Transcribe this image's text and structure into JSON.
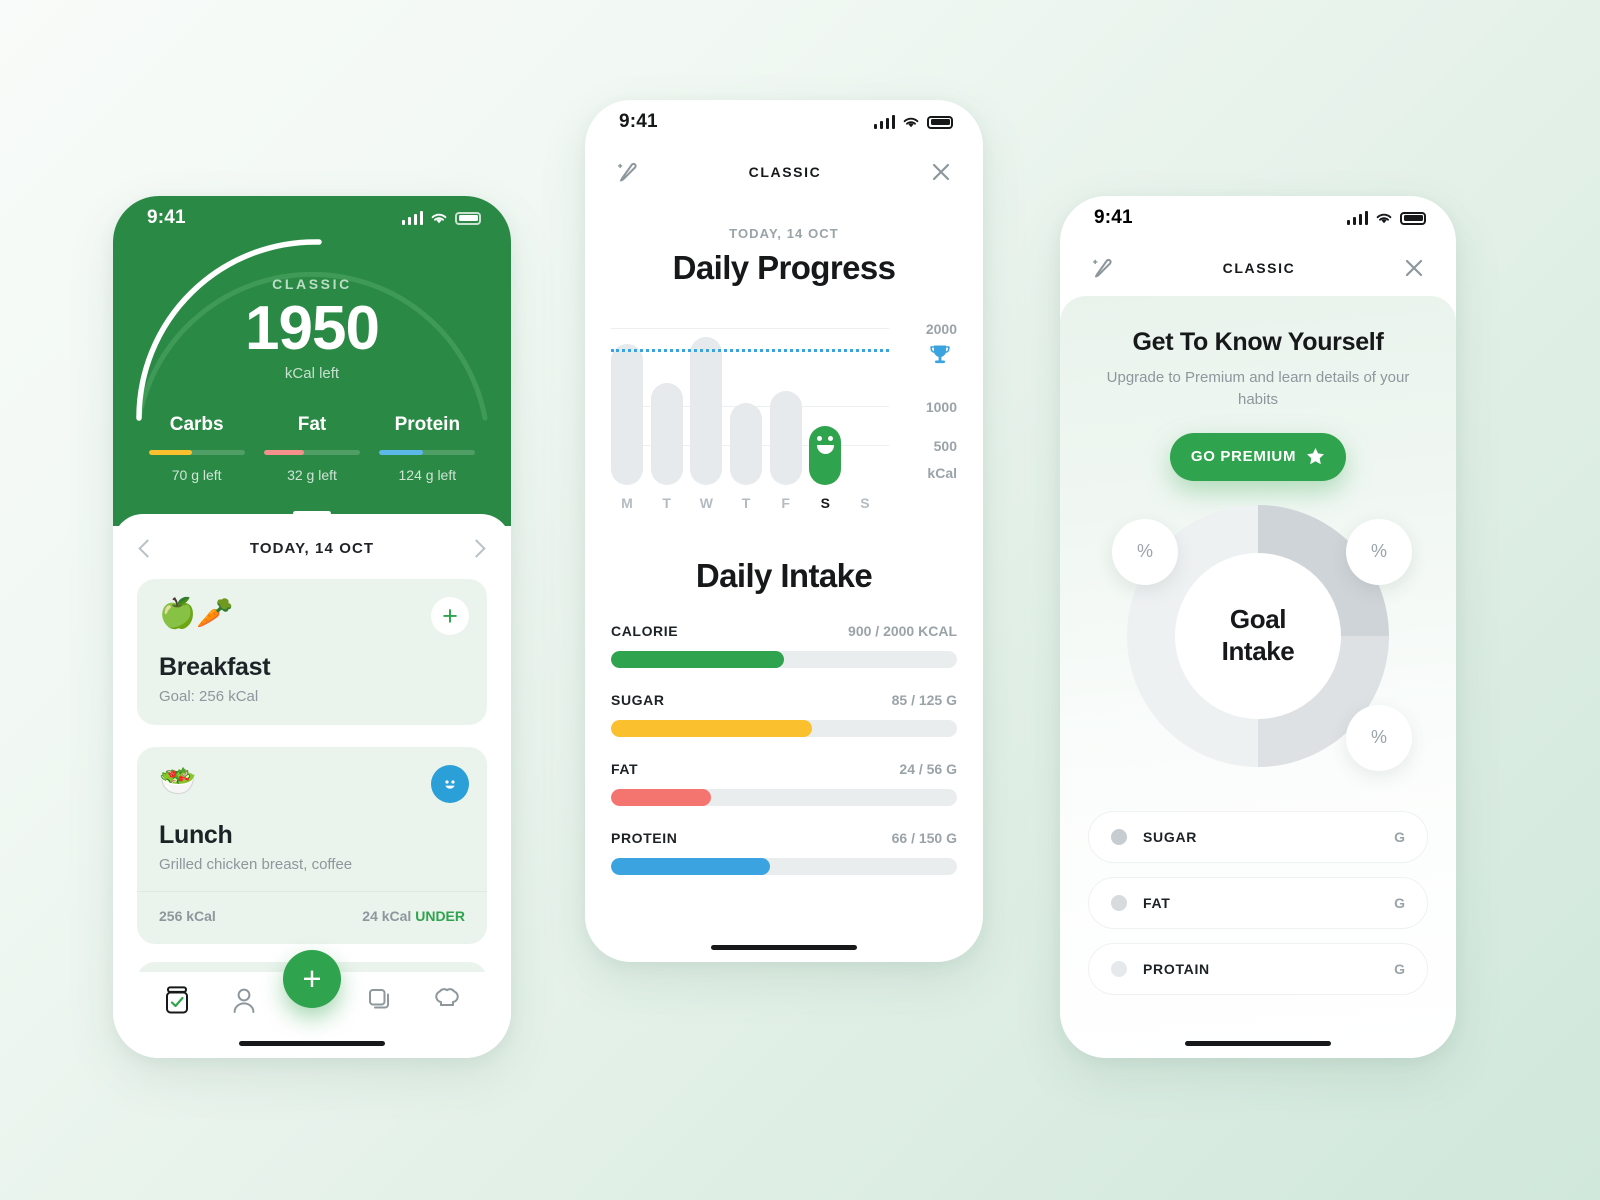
{
  "theme": {
    "green": "#2fa34d",
    "dark_green": "#2a8a45",
    "yellow": "#fbc02d",
    "red": "#f4756f",
    "blue": "#3aa3e0",
    "grey": "#e6eaec"
  },
  "phone1": {
    "status": {
      "time": "9:41"
    },
    "gauge": {
      "label": "CLASSIC",
      "value": "1950",
      "unit": "kCal left"
    },
    "macros": [
      {
        "name": "Carbs",
        "left": "70 g left",
        "pct": 45,
        "color": "#fbc02d"
      },
      {
        "name": "Fat",
        "left": "32 g left",
        "pct": 42,
        "color": "#f4918c"
      },
      {
        "name": "Protein",
        "left": "124 g left",
        "pct": 46,
        "color": "#5bb8e8"
      }
    ],
    "date_nav": {
      "title": "TODAY, 14 OCT",
      "prev": "‹",
      "next": "›"
    },
    "meals": [
      {
        "emoji": "🥗",
        "icon_name": "apple-carrot-emoji",
        "title": "Breakfast",
        "subtitle": "Goal: 256 kCal",
        "badge": "add"
      },
      {
        "emoji": "🥗",
        "icon_name": "salad-emoji",
        "title": "Lunch",
        "subtitle": "Grilled chicken breast, coffee",
        "badge": "smiley",
        "foot_left": "256 kCal",
        "foot_right": "24 kCal",
        "foot_tag": "UNDER"
      }
    ],
    "fab": "+",
    "tabs": [
      {
        "name": "diary",
        "icon": "checklist-icon"
      },
      {
        "name": "profile",
        "icon": "person-icon"
      },
      {
        "name": "plans",
        "icon": "layers-icon"
      },
      {
        "name": "recipes",
        "icon": "chef-hat-icon"
      }
    ]
  },
  "phone2": {
    "status": {
      "time": "9:41"
    },
    "navbar": {
      "title": "CLASSIC",
      "edit_icon": "pencil-sparkle-icon",
      "close_icon": "close-icon"
    },
    "kicker": "TODAY, 14 OCT",
    "title": "Daily Progress",
    "intake_title": "Daily Intake",
    "chart_data": {
      "type": "bar",
      "title": "Daily Progress",
      "categories": [
        "M",
        "T",
        "W",
        "T",
        "F",
        "S",
        "S"
      ],
      "values": [
        1800,
        1300,
        1900,
        1050,
        1200,
        750,
        0
      ],
      "highlight_index": 5,
      "highlight_label": "S",
      "goal_line": 1700,
      "goal_icon": "trophy-icon",
      "ylabel": "kCal",
      "ytick_labels": [
        "2000",
        "1000",
        "500",
        "kCal"
      ],
      "yticks": [
        2000,
        1000,
        500
      ],
      "ylim": [
        0,
        2100
      ],
      "grid": true,
      "legend": "none"
    },
    "intake": [
      {
        "name": "CALORIE",
        "value": "900 / 2000 KCAL",
        "pct": 50,
        "color": "#2fa34d"
      },
      {
        "name": "SUGAR",
        "value": "85 / 125 G",
        "pct": 58,
        "color": "#fbc02d"
      },
      {
        "name": "FAT",
        "value": "24 / 56 G",
        "pct": 29,
        "color": "#f4756f"
      },
      {
        "name": "PROTEIN",
        "value": "66 / 150 G",
        "pct": 46,
        "color": "#3aa3e0"
      }
    ]
  },
  "phone3": {
    "status": {
      "time": "9:41"
    },
    "navbar": {
      "title": "CLASSIC",
      "edit_icon": "pencil-sparkle-icon",
      "close_icon": "close-icon"
    },
    "promo": {
      "title": "Get To Know Yourself",
      "subtitle": "Upgrade to Premium and learn details of your habits",
      "button": "GO PREMIUM",
      "button_icon": "star-icon"
    },
    "donut": {
      "center": "Goal\nIntake",
      "center_line1": "Goal",
      "center_line2": "Intake",
      "bubbles": [
        "%",
        "%",
        "%"
      ],
      "segments": [
        {
          "color": "#cfd4d8",
          "from": 0,
          "to": 90
        },
        {
          "color": "#dde1e4",
          "from": 90,
          "to": 180
        },
        {
          "color": "#eef1f2",
          "from": 180,
          "to": 360
        }
      ]
    },
    "legend": [
      {
        "name": "SUGAR",
        "unit": "G",
        "color": "#c7ccd1"
      },
      {
        "name": "FAT",
        "unit": "G",
        "color": "#d7dbde"
      },
      {
        "name": "PROTAIN",
        "unit": "G",
        "color": "#e6e9eb"
      }
    ]
  }
}
